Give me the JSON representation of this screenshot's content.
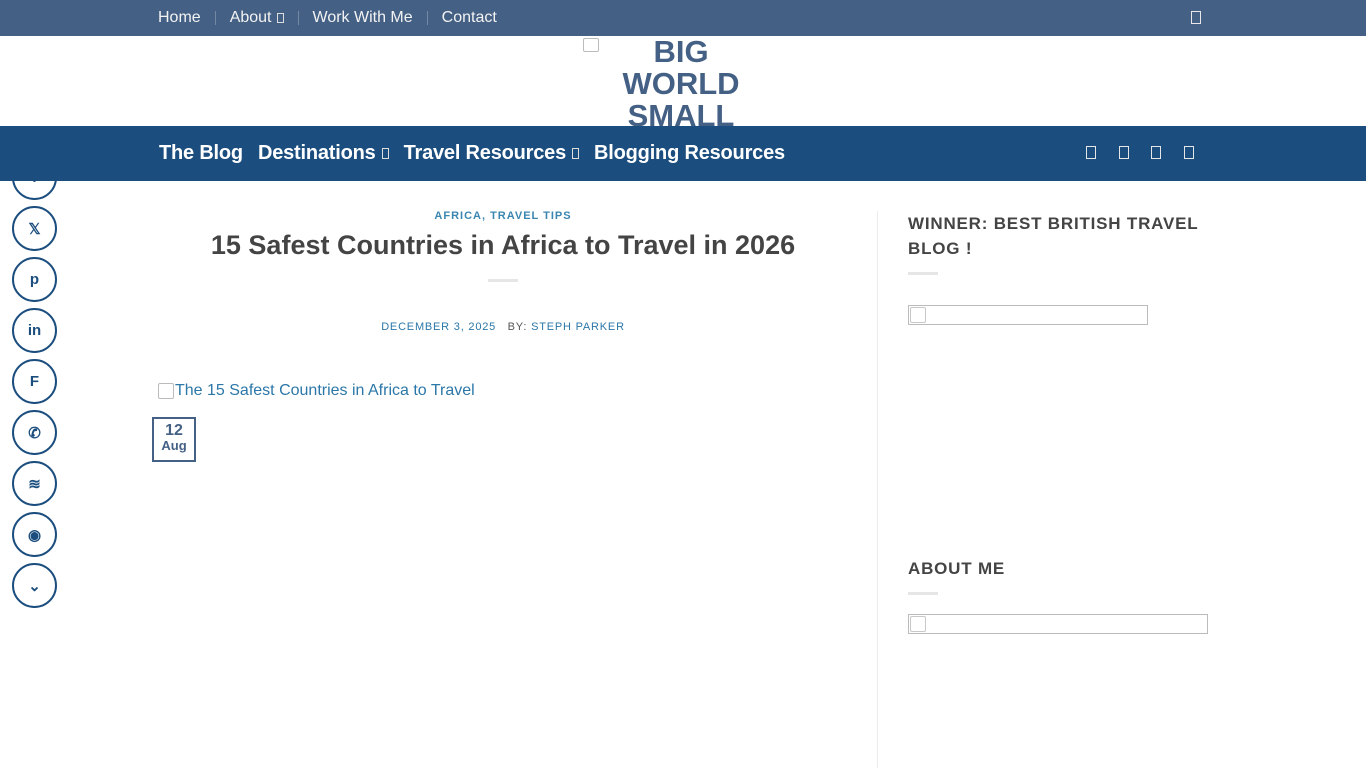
{
  "topnav": {
    "items": [
      {
        "label": "Home",
        "has_dropdown": false
      },
      {
        "label": "About",
        "has_dropdown": true
      },
      {
        "label": "Work With Me",
        "has_dropdown": false
      },
      {
        "label": "Contact",
        "has_dropdown": false
      }
    ],
    "search_icon": "search-icon"
  },
  "logo": {
    "alt_text": "BIG WORLD SMALL",
    "line1": "BIG",
    "line2": "WORLD",
    "line3": "SMALL"
  },
  "mainnav": {
    "items": [
      {
        "label": "The Blog",
        "has_dropdown": false
      },
      {
        "label": "Destinations",
        "has_dropdown": true
      },
      {
        "label": "Travel Resources",
        "has_dropdown": true
      },
      {
        "label": "Blogging Resources",
        "has_dropdown": false
      }
    ],
    "social_icons": [
      "facebook-icon",
      "instagram-icon",
      "twitter-icon",
      "pinterest-icon"
    ]
  },
  "share": {
    "icons": [
      {
        "name": "facebook-share-icon",
        "glyph": "f"
      },
      {
        "name": "x-share-icon",
        "glyph": "𝕏"
      },
      {
        "name": "pinterest-share-icon",
        "glyph": "p"
      },
      {
        "name": "linkedin-share-icon",
        "glyph": "in"
      },
      {
        "name": "flipboard-share-icon",
        "glyph": "F"
      },
      {
        "name": "whatsapp-share-icon",
        "glyph": "✆"
      },
      {
        "name": "buffer-share-icon",
        "glyph": "≋"
      },
      {
        "name": "reddit-share-icon",
        "glyph": "◉"
      },
      {
        "name": "pocket-share-icon",
        "glyph": "⌄"
      }
    ]
  },
  "article": {
    "category": "AFRICA, TRAVEL TIPS",
    "title": "15 Safest Countries in Africa to Travel in 2026",
    "date": "DECEMBER 3, 2025",
    "by_label": "BY:",
    "author": "STEPH PARKER",
    "featured_image_alt": "The 15 Safest Countries in Africa to Travel",
    "datebox_day": "12",
    "datebox_month": "Aug"
  },
  "sidebar": {
    "widget1_title_line1": "WINNER: BEST BRITISH TRAVEL",
    "widget1_title_line2": "BLOG !",
    "widget2_title": "ABOUT ME"
  },
  "colors": {
    "topbar": "#446084",
    "mainnav": "#1b4e7e",
    "link": "#2b77a8",
    "category": "#3a86b0"
  }
}
